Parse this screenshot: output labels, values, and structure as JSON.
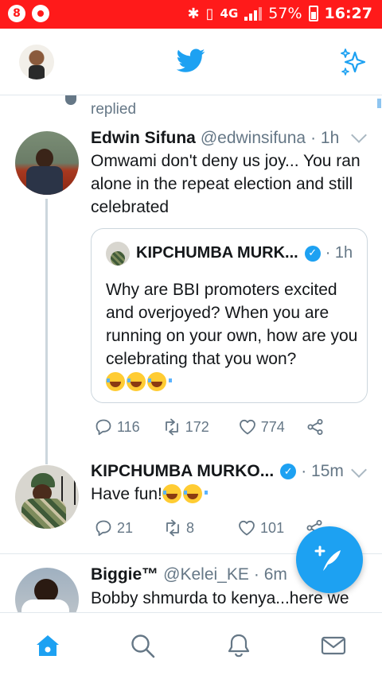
{
  "status_bar": {
    "left_icons": [
      "8",
      "media-icon"
    ],
    "network": "4G",
    "battery": "57%",
    "time": "16:27"
  },
  "top_bar": {
    "logo": "twitter-bird-icon",
    "right_icon": "sparkle-icon"
  },
  "thread_context": {
    "label": "replied"
  },
  "tweets": [
    {
      "name": "Edwin Sifuna",
      "handle": "@edwinsifuna",
      "time": "· 1h",
      "text": "Omwami don't deny us joy... You ran alone in the repeat election and still celebrated",
      "quote": {
        "name": "KIPCHUMBA MURK...",
        "verified": true,
        "time": "· 1h",
        "text": "Why are BBI promoters excited and overjoyed? When you are running on your own, how are you celebrating that you won?",
        "emoji_count": 3
      },
      "actions": {
        "replies": "116",
        "retweets": "172",
        "likes": "774"
      }
    },
    {
      "name": "KIPCHUMBA MURKO...",
      "verified": true,
      "time": "· 15m",
      "text": "Have fun!",
      "emoji_count": 2,
      "actions": {
        "replies": "21",
        "retweets": "8",
        "likes": "101"
      }
    },
    {
      "name": "Biggie™",
      "handle": "@Kelei_KE",
      "time": "· 6m",
      "text": "Bobby shmurda to kenya...here we"
    }
  ],
  "bottom_nav": [
    "home-icon",
    "search-icon",
    "notifications-icon",
    "messages-icon"
  ],
  "colors": {
    "accent": "#1da1f2",
    "status_bar": "#ff1a1a",
    "muted": "#657786"
  }
}
